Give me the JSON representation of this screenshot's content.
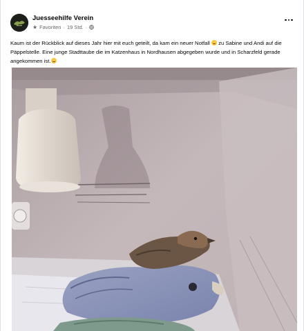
{
  "post": {
    "page_name": "Juesseehilfe Verein",
    "audience_label": "Favoriten",
    "separator": "·",
    "time": "19 Std.",
    "text_part1": "Kaum ist der Rückblick auf dieses Jahr hier mit euch geteilt, da kam ein neuer Notfall ",
    "text_part2": " zu Sabine und Andi auf die Päppelstelle. Eine junge Stadttaube die im Katzenhaus in Nordhausen abgegeben wurde und in Scharzfeld gerade angekommen ist.",
    "icons": {
      "star": "star-icon",
      "globe": "globe-icon",
      "more": "more-options-icon",
      "emoji": "emoji-icon"
    }
  },
  "colors": {
    "name": "#050505",
    "meta": "#65676b",
    "card": "#ffffff"
  }
}
